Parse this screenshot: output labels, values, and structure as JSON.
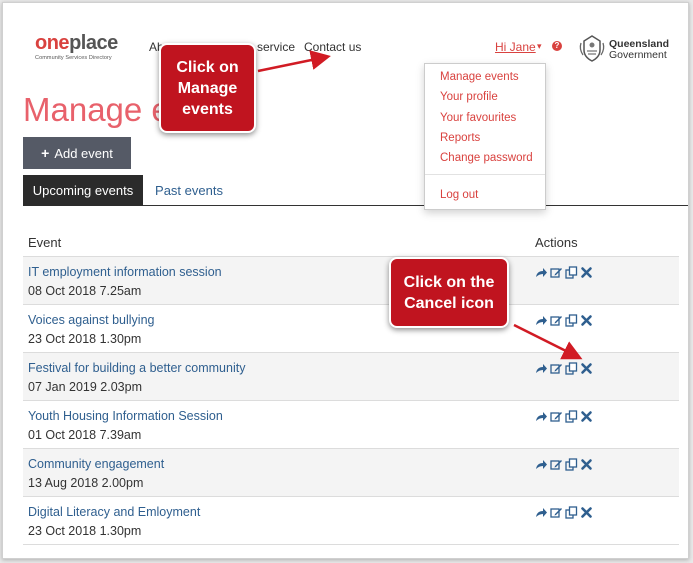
{
  "header": {
    "logo_one": "one",
    "logo_place": "place",
    "logo_sub": "Community Services Directory",
    "nav": {
      "about": "Ab",
      "service": "service",
      "contact": "Contact us"
    },
    "user_greeting": "Hi Jane",
    "user_caret": "▾",
    "help_glyph": "?",
    "gov_name_line1": "Queensland",
    "gov_name_line2": "Government"
  },
  "page": {
    "title": "Manage e",
    "add_button_icon": "+",
    "add_button_label": "Add event"
  },
  "tabs": [
    {
      "label": "Upcoming events",
      "active": true
    },
    {
      "label": "Past events",
      "active": false
    }
  ],
  "table": {
    "col_event": "Event",
    "col_actions": "Actions",
    "rows": [
      {
        "title": "IT employment information session",
        "date": "08 Oct 2018 7.25am"
      },
      {
        "title": "Voices against bullying",
        "date": "23 Oct 2018 1.30pm"
      },
      {
        "title": "Festival for building a better community",
        "date": "07 Jan 2019 2.03pm"
      },
      {
        "title": "Youth Housing Information Session",
        "date": "01 Oct 2018 7.39am"
      },
      {
        "title": "Community engagement",
        "date": "13 Aug 2018 2.00pm"
      },
      {
        "title": "Digital Literacy and Emloyment",
        "date": "23 Oct 2018 1.30pm"
      }
    ],
    "action_icons": [
      "share-icon",
      "edit-icon",
      "copy-icon",
      "cancel-icon"
    ]
  },
  "dropdown": {
    "items": [
      "Manage events",
      "Your profile",
      "Your favourites",
      "Reports",
      "Change password"
    ],
    "logout": "Log out"
  },
  "callouts": {
    "manage": "Click on Manage events",
    "cancel": "Click on the Cancel icon"
  },
  "colors": {
    "brand_red": "#d9423f",
    "title_pink": "#e8616b",
    "link_blue": "#2f5f8f",
    "callout_red": "#c0141f",
    "button_gray": "#555a66"
  }
}
